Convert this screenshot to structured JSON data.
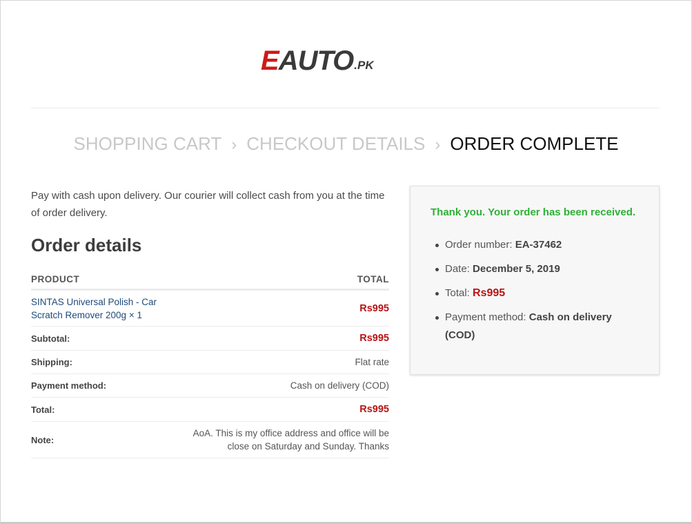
{
  "logo": {
    "part1": "E",
    "part2": "AUTO",
    "part3": ".PK"
  },
  "steps": [
    {
      "label": "SHOPPING CART"
    },
    {
      "label": "CHECKOUT DETAILS"
    },
    {
      "label": "ORDER COMPLETE"
    }
  ],
  "separator": "›",
  "intro": "Pay with cash upon delivery. Our courier will collect cash from you at the time of order delivery.",
  "order_details": {
    "title": "Order details",
    "headers": {
      "product": "PRODUCT",
      "total": "TOTAL"
    },
    "item": {
      "name": "SINTAS Universal Polish - Car Scratch Remover 200g",
      "qty": " × 1",
      "price": "Rs995"
    },
    "subtotal": {
      "label": "Subtotal:",
      "value": "Rs995"
    },
    "shipping": {
      "label": "Shipping:",
      "value": "Flat rate"
    },
    "payment": {
      "label": "Payment method:",
      "value": "Cash on delivery (COD)"
    },
    "total": {
      "label": "Total:",
      "value": "Rs995"
    },
    "note": {
      "label": "Note:",
      "value": "AoA. This is my office address and office will be close on Saturday and Sunday. Thanks"
    }
  },
  "summary": {
    "thanks": "Thank you. Your order has been received.",
    "order_number": {
      "label": "Order number: ",
      "value": "EA-37462"
    },
    "date": {
      "label": "Date: ",
      "value": "December 5, 2019"
    },
    "total": {
      "label": "Total: ",
      "value": "Rs995"
    },
    "payment": {
      "label": "Payment method: ",
      "value": "Cash on delivery (COD)"
    }
  },
  "colors": {
    "accent_red": "#b81414",
    "success_green": "#2fb037",
    "link_blue": "#1e4a7a"
  }
}
